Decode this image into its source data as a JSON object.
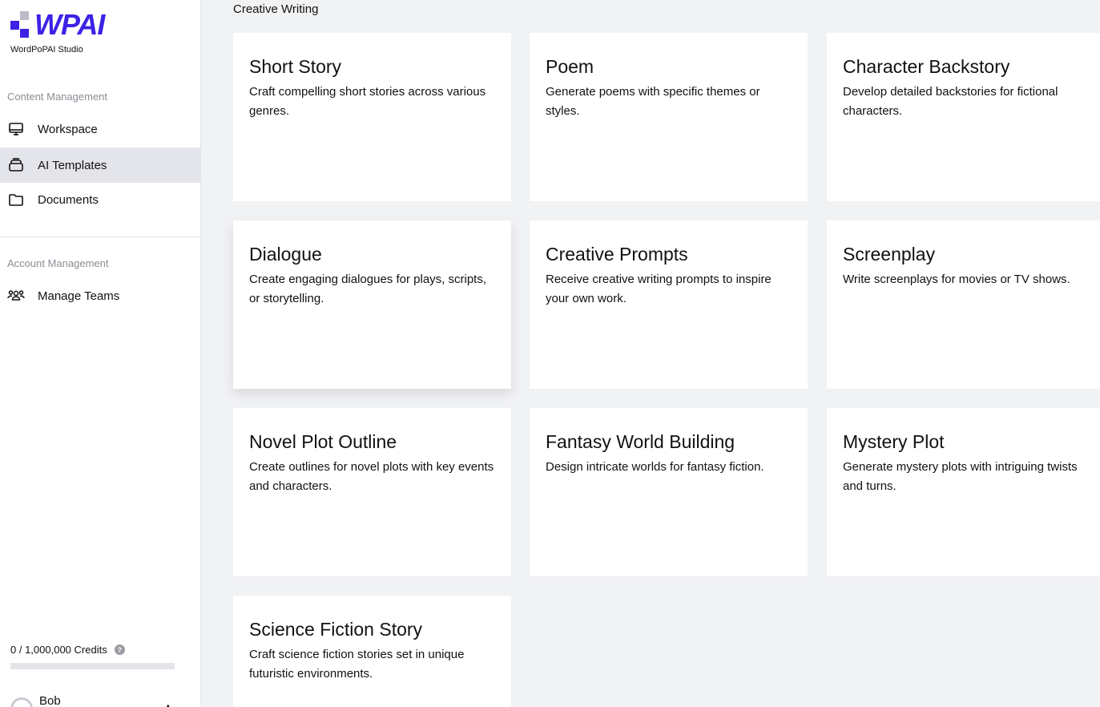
{
  "brand": {
    "logo_text": "WPAI",
    "subtitle": "WordPoPAI Studio",
    "colors": {
      "primary": "#3d22e6",
      "secondary": "#b9bbc6"
    }
  },
  "sidebar": {
    "content_section_label": "Content Management",
    "content_items": [
      {
        "label": "Workspace",
        "icon": "monitor-icon"
      },
      {
        "label": "AI Templates",
        "icon": "stack-icon",
        "active": true
      },
      {
        "label": "Documents",
        "icon": "folder-icon"
      }
    ],
    "account_section_label": "Account Management",
    "account_items": [
      {
        "label": "Manage Teams",
        "icon": "team-icon"
      }
    ],
    "credits": {
      "text": "0 / 1,000,000 Credits",
      "used_fraction": 0
    },
    "user": {
      "name": "Bob"
    }
  },
  "main": {
    "category_title": "Creative Writing",
    "cards": [
      {
        "title": "Short Story",
        "description": "Craft compelling short stories across various genres."
      },
      {
        "title": "Poem",
        "description": "Generate poems with specific themes or styles."
      },
      {
        "title": "Character Backstory",
        "description": "Develop detailed backstories for fictional characters."
      },
      {
        "title": "Dialogue",
        "description": "Create engaging dialogues for plays, scripts, or storytelling."
      },
      {
        "title": "Creative Prompts",
        "description": "Receive creative writing prompts to inspire your own work."
      },
      {
        "title": "Screenplay",
        "description": "Write screenplays for movies or TV shows."
      },
      {
        "title": "Novel Plot Outline",
        "description": "Create outlines for novel plots with key events and characters."
      },
      {
        "title": "Fantasy World Building",
        "description": "Design intricate worlds for fantasy fiction."
      },
      {
        "title": "Mystery Plot",
        "description": "Generate mystery plots with intriguing twists and turns."
      },
      {
        "title": "Science Fiction Story",
        "description": "Craft science fiction stories set in unique futuristic environments."
      }
    ]
  }
}
